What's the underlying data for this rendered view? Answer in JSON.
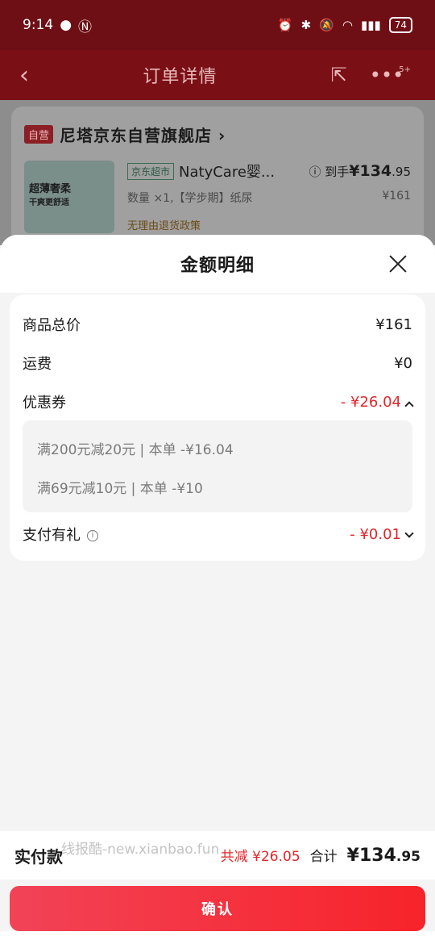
{
  "status": {
    "time": "9:14",
    "battery": "74"
  },
  "nav": {
    "title": "订单详情",
    "badge": "5+"
  },
  "store": {
    "tag": "自营",
    "name": "尼塔京东自营旗舰店 ›",
    "product": {
      "channel": "京东超市",
      "name": "NatyCare婴...",
      "img_text": "超薄奢柔",
      "img_sub": "干爽更舒适",
      "price_label": "到手",
      "price_main": "¥134",
      "price_cents": ".95",
      "spec": "数量 ×1,【学步期】纸尿",
      "orig_price": "¥161",
      "policy": "无理由退货政策"
    }
  },
  "sheet": {
    "title": "金额明细",
    "rows": {
      "goods_total": {
        "label": "商品总价",
        "value": "¥161"
      },
      "shipping": {
        "label": "运费",
        "value": "¥0"
      },
      "coupon": {
        "label": "优惠券",
        "value": "- ¥26.04"
      },
      "gift": {
        "label": "支付有礼",
        "value": "- ¥0.01"
      }
    },
    "coupons": [
      "满200元减20元 | 本单 -¥16.04",
      "满69元减10元 | 本单 -¥10"
    ]
  },
  "footer": {
    "pay_label": "实付款",
    "watermark": "线报酷-new.xianbao.fun",
    "saved": "共减 ¥26.05",
    "total_label": "合计",
    "total_main": "¥134",
    "total_cents": ".95",
    "confirm": "确认"
  }
}
